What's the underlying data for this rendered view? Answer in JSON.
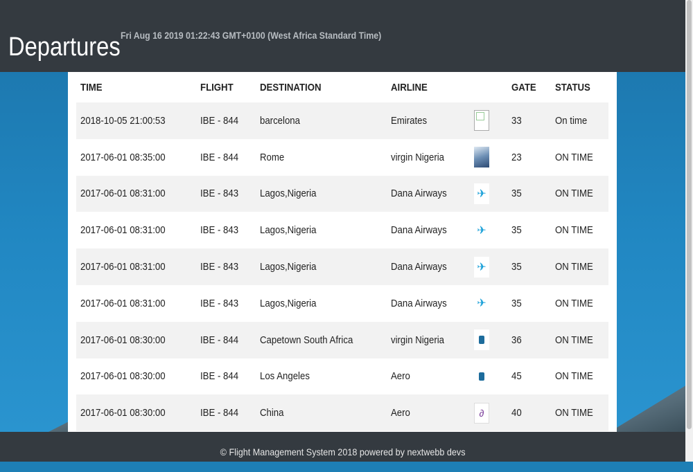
{
  "header": {
    "title": "Departures",
    "datetime": "Fri Aug 16 2019 01:22:43 GMT+0100 (West Africa Standard Time)"
  },
  "table": {
    "columns": [
      "TIME",
      "FLIGHT",
      "DESTINATION",
      "AIRLINE",
      "",
      "GATE",
      "STATUS"
    ],
    "rows": [
      {
        "time": "2018-10-05 21:00:53",
        "flight": "IBE - 844",
        "destination": "barcelona",
        "airline": "Emirates",
        "logo": "broken-image-icon",
        "gate": "33",
        "status": "On time"
      },
      {
        "time": "2017-06-01 08:35:00",
        "flight": "IBE - 844",
        "destination": "Rome",
        "airline": "virgin Nigeria",
        "logo": "sky-photo-icon",
        "gate": "23",
        "status": "ON TIME"
      },
      {
        "time": "2017-06-01 08:31:00",
        "flight": "IBE - 843",
        "destination": "Lagos,Nigeria",
        "airline": "Dana Airways",
        "logo": "airplane-icon",
        "gate": "35",
        "status": "ON TIME"
      },
      {
        "time": "2017-06-01 08:31:00",
        "flight": "IBE - 843",
        "destination": "Lagos,Nigeria",
        "airline": "Dana Airways",
        "logo": "airplane-icon",
        "gate": "35",
        "status": "ON TIME"
      },
      {
        "time": "2017-06-01 08:31:00",
        "flight": "IBE - 843",
        "destination": "Lagos,Nigeria",
        "airline": "Dana Airways",
        "logo": "airplane-icon",
        "gate": "35",
        "status": "ON TIME"
      },
      {
        "time": "2017-06-01 08:31:00",
        "flight": "IBE - 843",
        "destination": "Lagos,Nigeria",
        "airline": "Dana Airways",
        "logo": "airplane-icon",
        "gate": "35",
        "status": "ON TIME"
      },
      {
        "time": "2017-06-01 08:30:00",
        "flight": "IBE - 844",
        "destination": "Capetown South Africa",
        "airline": "virgin Nigeria",
        "logo": "aero-logo-icon",
        "gate": "36",
        "status": "ON TIME"
      },
      {
        "time": "2017-06-01 08:30:00",
        "flight": "IBE - 844",
        "destination": "Los Angeles",
        "airline": "Aero",
        "logo": "aero-logo-icon",
        "gate": "45",
        "status": "ON TIME"
      },
      {
        "time": "2017-06-01 08:30:00",
        "flight": "IBE - 844",
        "destination": "China",
        "airline": "Aero",
        "logo": "swirl-logo-icon",
        "gate": "40",
        "status": "ON TIME"
      }
    ]
  },
  "footer": {
    "text": "© Flight Management System 2018 powered by nextwebb devs"
  },
  "colors": {
    "header_bg": "#343a40",
    "background_sky": "#1e7fb5"
  }
}
